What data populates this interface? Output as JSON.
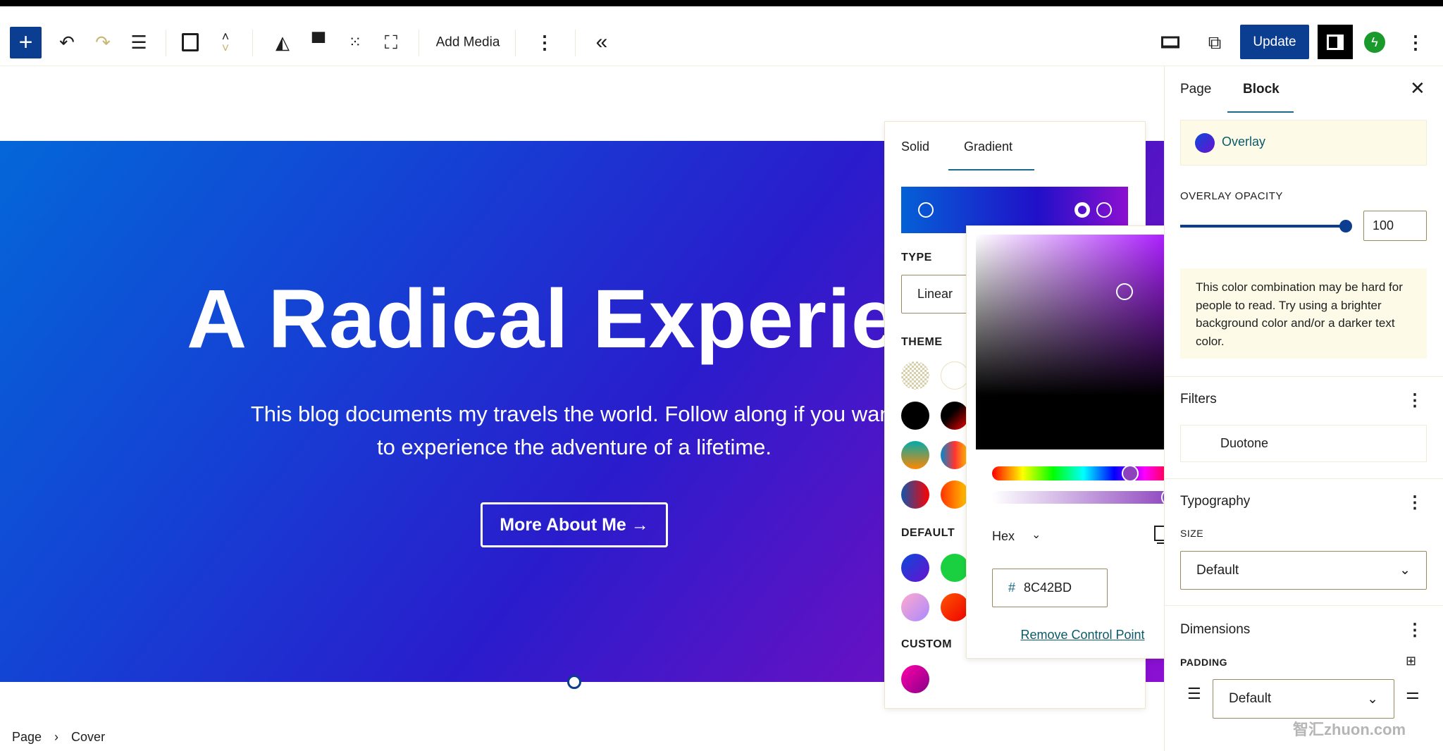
{
  "toolbar": {
    "add_media": "Add Media",
    "update": "Update",
    "icons": [
      "plus-icon",
      "undo-icon",
      "redo-icon",
      "list-view-icon",
      "bookmark-icon",
      "move-up-down-icon",
      "contrast-icon",
      "align-icon",
      "grid-icon",
      "fullscreen-icon",
      "more-vertical-icon",
      "collapse-icon",
      "laptop-icon",
      "external-link-icon",
      "sidebar-icon",
      "jetpack-icon"
    ]
  },
  "cover": {
    "heading": "A Radical  Experience",
    "paragraph_line1": "This blog documents my travels the world. Follow along if you want",
    "paragraph_line2": "to experience the adventure of a lifetime.",
    "button": "More About Me →"
  },
  "breadcrumb": {
    "items": [
      "Page",
      "Cover"
    ],
    "separator": "›"
  },
  "gradient_popover": {
    "tabs": [
      "Solid",
      "Gradient"
    ],
    "active_tab": "Gradient",
    "type_label": "TYPE",
    "type_value": "Linear",
    "theme_label": "THEME",
    "default_label": "DEFAULT",
    "custom_label": "CUSTOM"
  },
  "color_picker": {
    "format": "Hex",
    "hash": "#",
    "hex_value": "8C42BD",
    "remove": "Remove Control Point",
    "hue_color": "#8c42bd"
  },
  "sidebar": {
    "tabs": [
      "Page",
      "Block"
    ],
    "active_tab": "Block",
    "overlay": "Overlay",
    "overlay_opacity_label": "OVERLAY OPACITY",
    "overlay_opacity": "100",
    "warning": "This color combination may be hard for people to read. Try using a brighter background color and/or a darker text color.",
    "filters": "Filters",
    "duotone": "Duotone",
    "typography": "Typography",
    "size_label": "SIZE",
    "size_value": "Default",
    "dimensions": "Dimensions",
    "padding_label": "PADDING",
    "padding_value": "Default"
  },
  "watermark": "智汇zhuon.com"
}
